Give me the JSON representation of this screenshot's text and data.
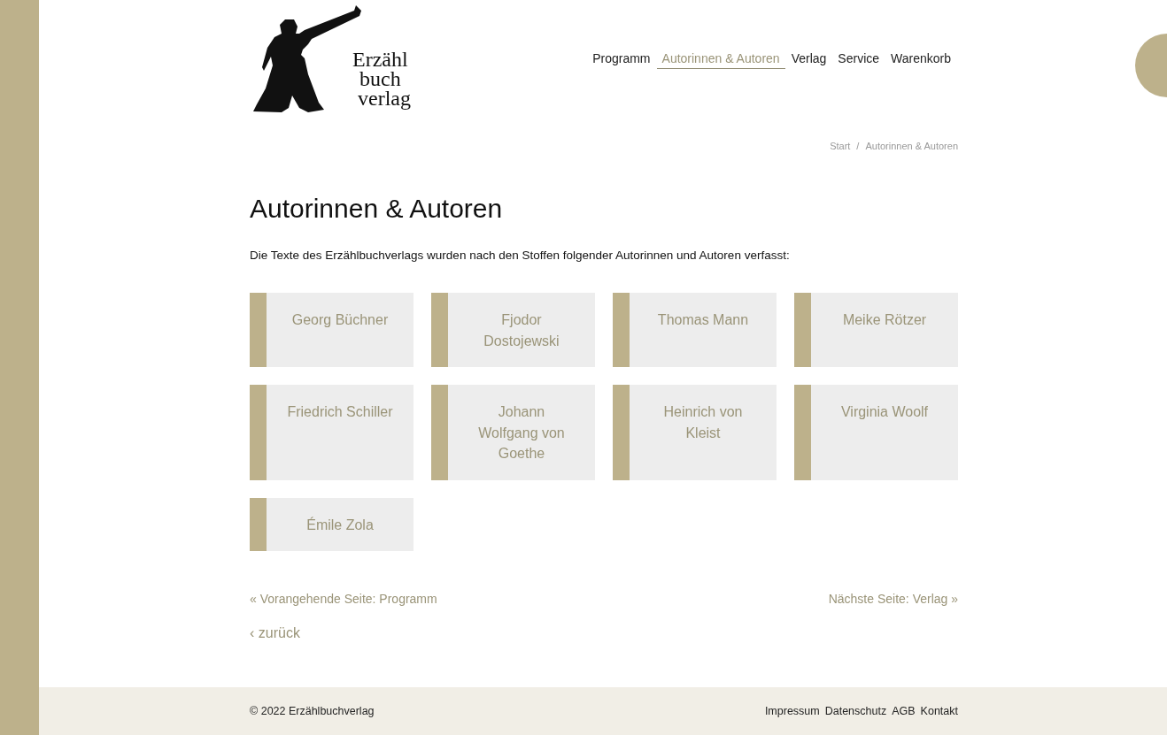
{
  "logo": {
    "lines": [
      "Erzähl",
      "buch",
      "verlag"
    ]
  },
  "nav": [
    {
      "label": "Programm",
      "selected": false
    },
    {
      "label": "Autorinnen & Autoren",
      "selected": true
    },
    {
      "label": "Verlag",
      "selected": false
    },
    {
      "label": "Service",
      "selected": false
    },
    {
      "label": "Warenkorb",
      "selected": false
    }
  ],
  "breadcrumb": [
    "Start",
    "Autorinnen & Autoren"
  ],
  "breadcrumb_separator": "/",
  "heading": "Autorinnen & Autoren",
  "intro": "Die Texte des Erzählbuchverlags wurden nach den Stoffen folgender Autorinnen und Autoren verfasst:",
  "authors": [
    "Georg Büchner",
    "Fjodor Dostojewski",
    "Thomas Mann",
    "Meike Rötzer",
    "Friedrich Schiller",
    "Johann Wolfgang von Goethe",
    "Heinrich von Kleist",
    "Virginia Woolf",
    "Émile Zola"
  ],
  "pager": {
    "previous": "« Vorangehende Seite: Programm",
    "next": "Nächste Seite: Verlag »",
    "back": "‹ zurück"
  },
  "footer": {
    "copyright": "© 2022 Erzählbuchverlag",
    "links": [
      "Impressum",
      "Datenschutz",
      "AGB",
      "Kontakt"
    ]
  }
}
